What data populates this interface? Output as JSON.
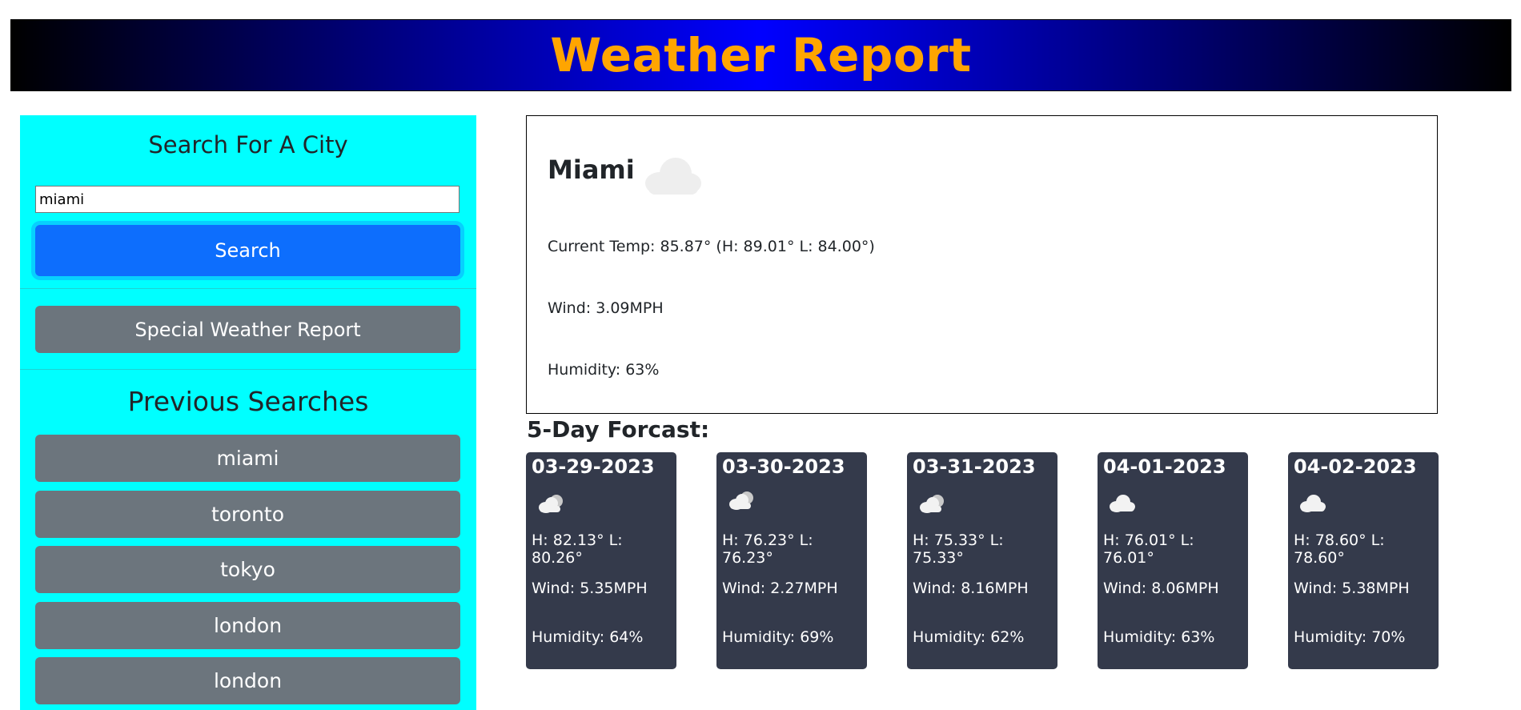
{
  "header": {
    "title": "Weather Report"
  },
  "sidebar": {
    "search_title": "Search For A City",
    "search_value": "miami",
    "search_button": "Search",
    "special_button": "Special Weather Report",
    "previous_title": "Previous Searches",
    "previous": [
      "miami",
      "toronto",
      "tokyo",
      "london",
      "london"
    ]
  },
  "current": {
    "city": "Miami",
    "icon": "cloud-icon",
    "temp": "Current Temp: 85.87° (H: 89.01° L: 84.00°)",
    "wind": "Wind: 3.09MPH",
    "humidity": "Humidity: 63%"
  },
  "forecast": {
    "title": "5-Day Forcast:",
    "days": [
      {
        "date": "03-29-2023",
        "icon": "partly-cloudy-icon",
        "hl": "H: 82.13° L: 80.26°",
        "wind": "Wind: 5.35MPH",
        "humidity": "Humidity: 64%"
      },
      {
        "date": "03-30-2023",
        "icon": "partly-cloudy-icon",
        "hl": "H: 76.23° L: 76.23°",
        "wind": "Wind: 2.27MPH",
        "humidity": "Humidity: 69%"
      },
      {
        "date": "03-31-2023",
        "icon": "partly-cloudy-icon",
        "hl": "H: 75.33° L: 75.33°",
        "wind": "Wind: 8.16MPH",
        "humidity": "Humidity: 62%"
      },
      {
        "date": "04-01-2023",
        "icon": "cloud-icon",
        "hl": "H: 76.01° L: 76.01°",
        "wind": "Wind: 8.06MPH",
        "humidity": "Humidity: 63%"
      },
      {
        "date": "04-02-2023",
        "icon": "cloud-icon",
        "hl": "H: 78.60° L: 78.60°",
        "wind": "Wind: 5.38MPH",
        "humidity": "Humidity: 70%"
      }
    ]
  },
  "colors": {
    "title": "#ffa500",
    "sidebar_bg": "#00ffff",
    "primary": "#0d6efd",
    "secondary": "#6c757d",
    "card_bg": "#343a4b"
  }
}
